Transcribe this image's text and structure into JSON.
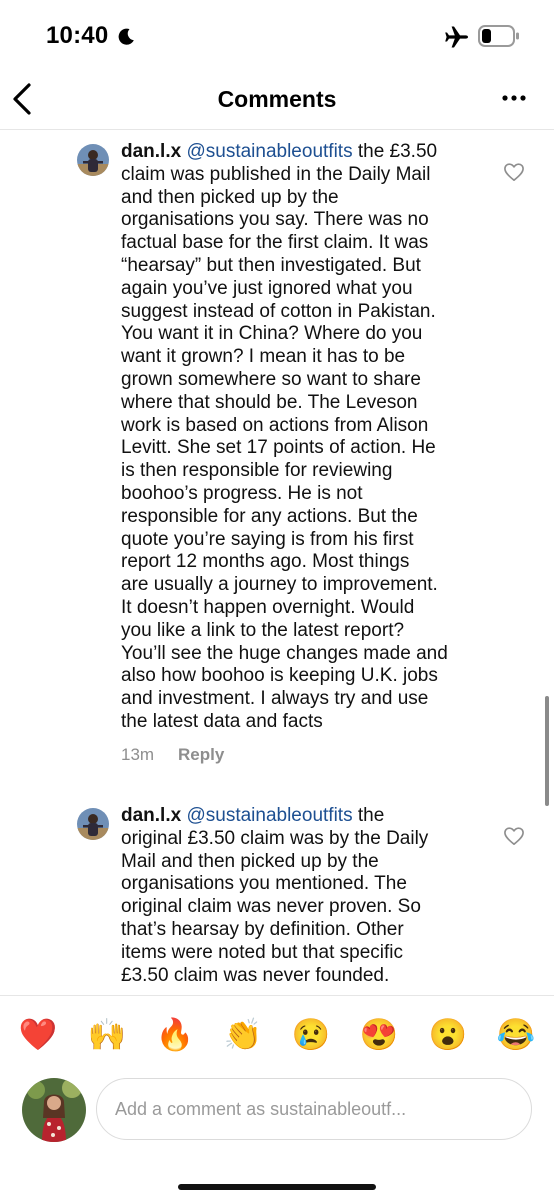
{
  "status_bar": {
    "time": "10:40",
    "icons": [
      "moon-icon",
      "airplane-icon",
      "battery-icon"
    ]
  },
  "nav": {
    "title": "Comments",
    "back_icon": "chevron-left-icon",
    "more_icon": "more-horizontal-icon"
  },
  "comments": [
    {
      "username": "dan.l.x",
      "mention": "@sustainableoutfits",
      "lines": [
        " the £3.50",
        "claim was published in the Daily Mail",
        "and then picked up by the",
        "organisations you say.  There was no",
        "factual base for the first claim.  It was",
        "“hearsay” but then investigated.  But",
        "again you’ve just ignored what you",
        "suggest instead of cotton in Pakistan.",
        "You want it in China?  Where do you",
        "want it grown?  I mean it has to be",
        "grown somewhere so want to share",
        "where that should be.  The Leveson",
        "work is based on actions from Alison",
        "Levitt.  She set 17 points of action.  He",
        "is then responsible for reviewing",
        "boohoo’s progress.  He is not",
        "responsible for any actions.  But the",
        "quote you’re saying is from his first",
        "report 12 months ago.  Most things",
        "are usually a journey to improvement.",
        "It doesn’t happen overnight.  Would",
        "you like a link to the latest report?",
        "You’ll see the huge changes made and",
        "also how boohoo is keeping U.K. jobs",
        "and investment.  I always try and use",
        "the latest data and facts"
      ],
      "time": "13m",
      "reply_label": "Reply"
    },
    {
      "username": "dan.l.x",
      "mention": "@sustainableoutfits",
      "lines": [
        " the",
        "original £3.50 claim was by the Daily",
        "Mail and then picked up by the",
        "organisations you mentioned.  The",
        "original claim was never proven.  So",
        "that’s hearsay by definition.  Other",
        "items were noted but that specific",
        "£3.50 claim was never founded."
      ]
    }
  ],
  "emoji_bar": [
    "❤️",
    "🙌",
    "🔥",
    "👏",
    "😢",
    "😍",
    "😮",
    "😂"
  ],
  "composer": {
    "placeholder": "Add a comment as sustainableoutf..."
  },
  "colors": {
    "mention": "#1d4f91",
    "meta": "#8e8e8e",
    "divider": "#e6e6e6"
  }
}
